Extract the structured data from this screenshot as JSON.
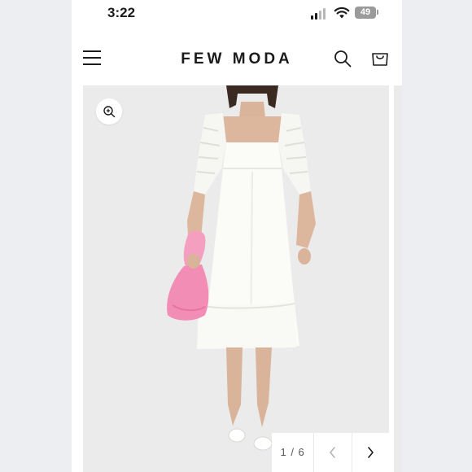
{
  "status_bar": {
    "time": "3:22",
    "battery_level": "49"
  },
  "header": {
    "brand": "FEW MODA",
    "menu_icon": "hamburger-menu-icon",
    "search_icon": "search-icon",
    "cart_icon": "shopping-bag-icon"
  },
  "gallery": {
    "counter": "1 / 6",
    "zoom_icon": "zoom-in-icon",
    "prev_icon": "chevron-left-icon",
    "next_icon": "chevron-right-icon",
    "image_alt": "Model wearing white square-neck ruched-sleeve midi dress holding a pink handbag"
  },
  "colors": {
    "text": "#1b1b1b",
    "gallery_bg": "#ebebeb",
    "dress": "#fbfbf8",
    "bag": "#f28db5"
  }
}
